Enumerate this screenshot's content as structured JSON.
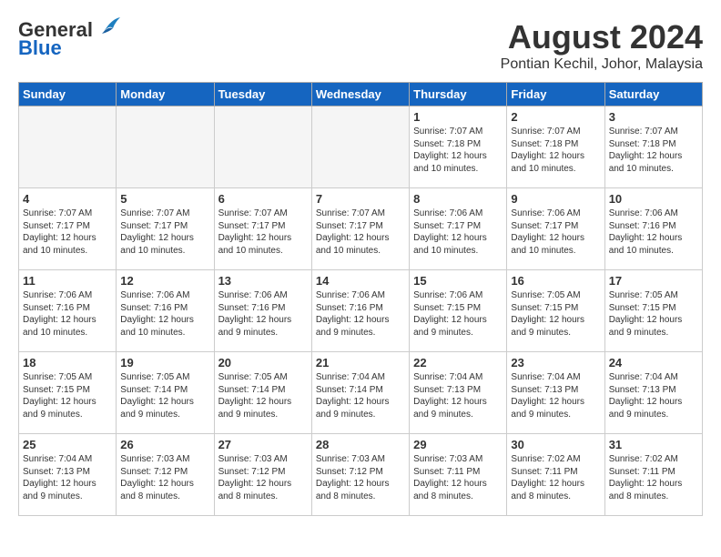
{
  "header": {
    "logo_general": "General",
    "logo_blue": "Blue",
    "main_title": "August 2024",
    "subtitle": "Pontian Kechil, Johor, Malaysia"
  },
  "calendar": {
    "days_of_week": [
      "Sunday",
      "Monday",
      "Tuesday",
      "Wednesday",
      "Thursday",
      "Friday",
      "Saturday"
    ],
    "weeks": [
      [
        {
          "day": "",
          "info": ""
        },
        {
          "day": "",
          "info": ""
        },
        {
          "day": "",
          "info": ""
        },
        {
          "day": "",
          "info": ""
        },
        {
          "day": "1",
          "info": "Sunrise: 7:07 AM\nSunset: 7:18 PM\nDaylight: 12 hours\nand 10 minutes."
        },
        {
          "day": "2",
          "info": "Sunrise: 7:07 AM\nSunset: 7:18 PM\nDaylight: 12 hours\nand 10 minutes."
        },
        {
          "day": "3",
          "info": "Sunrise: 7:07 AM\nSunset: 7:18 PM\nDaylight: 12 hours\nand 10 minutes."
        }
      ],
      [
        {
          "day": "4",
          "info": "Sunrise: 7:07 AM\nSunset: 7:17 PM\nDaylight: 12 hours\nand 10 minutes."
        },
        {
          "day": "5",
          "info": "Sunrise: 7:07 AM\nSunset: 7:17 PM\nDaylight: 12 hours\nand 10 minutes."
        },
        {
          "day": "6",
          "info": "Sunrise: 7:07 AM\nSunset: 7:17 PM\nDaylight: 12 hours\nand 10 minutes."
        },
        {
          "day": "7",
          "info": "Sunrise: 7:07 AM\nSunset: 7:17 PM\nDaylight: 12 hours\nand 10 minutes."
        },
        {
          "day": "8",
          "info": "Sunrise: 7:06 AM\nSunset: 7:17 PM\nDaylight: 12 hours\nand 10 minutes."
        },
        {
          "day": "9",
          "info": "Sunrise: 7:06 AM\nSunset: 7:17 PM\nDaylight: 12 hours\nand 10 minutes."
        },
        {
          "day": "10",
          "info": "Sunrise: 7:06 AM\nSunset: 7:16 PM\nDaylight: 12 hours\nand 10 minutes."
        }
      ],
      [
        {
          "day": "11",
          "info": "Sunrise: 7:06 AM\nSunset: 7:16 PM\nDaylight: 12 hours\nand 10 minutes."
        },
        {
          "day": "12",
          "info": "Sunrise: 7:06 AM\nSunset: 7:16 PM\nDaylight: 12 hours\nand 10 minutes."
        },
        {
          "day": "13",
          "info": "Sunrise: 7:06 AM\nSunset: 7:16 PM\nDaylight: 12 hours\nand 9 minutes."
        },
        {
          "day": "14",
          "info": "Sunrise: 7:06 AM\nSunset: 7:16 PM\nDaylight: 12 hours\nand 9 minutes."
        },
        {
          "day": "15",
          "info": "Sunrise: 7:06 AM\nSunset: 7:15 PM\nDaylight: 12 hours\nand 9 minutes."
        },
        {
          "day": "16",
          "info": "Sunrise: 7:05 AM\nSunset: 7:15 PM\nDaylight: 12 hours\nand 9 minutes."
        },
        {
          "day": "17",
          "info": "Sunrise: 7:05 AM\nSunset: 7:15 PM\nDaylight: 12 hours\nand 9 minutes."
        }
      ],
      [
        {
          "day": "18",
          "info": "Sunrise: 7:05 AM\nSunset: 7:15 PM\nDaylight: 12 hours\nand 9 minutes."
        },
        {
          "day": "19",
          "info": "Sunrise: 7:05 AM\nSunset: 7:14 PM\nDaylight: 12 hours\nand 9 minutes."
        },
        {
          "day": "20",
          "info": "Sunrise: 7:05 AM\nSunset: 7:14 PM\nDaylight: 12 hours\nand 9 minutes."
        },
        {
          "day": "21",
          "info": "Sunrise: 7:04 AM\nSunset: 7:14 PM\nDaylight: 12 hours\nand 9 minutes."
        },
        {
          "day": "22",
          "info": "Sunrise: 7:04 AM\nSunset: 7:13 PM\nDaylight: 12 hours\nand 9 minutes."
        },
        {
          "day": "23",
          "info": "Sunrise: 7:04 AM\nSunset: 7:13 PM\nDaylight: 12 hours\nand 9 minutes."
        },
        {
          "day": "24",
          "info": "Sunrise: 7:04 AM\nSunset: 7:13 PM\nDaylight: 12 hours\nand 9 minutes."
        }
      ],
      [
        {
          "day": "25",
          "info": "Sunrise: 7:04 AM\nSunset: 7:13 PM\nDaylight: 12 hours\nand 9 minutes."
        },
        {
          "day": "26",
          "info": "Sunrise: 7:03 AM\nSunset: 7:12 PM\nDaylight: 12 hours\nand 8 minutes."
        },
        {
          "day": "27",
          "info": "Sunrise: 7:03 AM\nSunset: 7:12 PM\nDaylight: 12 hours\nand 8 minutes."
        },
        {
          "day": "28",
          "info": "Sunrise: 7:03 AM\nSunset: 7:12 PM\nDaylight: 12 hours\nand 8 minutes."
        },
        {
          "day": "29",
          "info": "Sunrise: 7:03 AM\nSunset: 7:11 PM\nDaylight: 12 hours\nand 8 minutes."
        },
        {
          "day": "30",
          "info": "Sunrise: 7:02 AM\nSunset: 7:11 PM\nDaylight: 12 hours\nand 8 minutes."
        },
        {
          "day": "31",
          "info": "Sunrise: 7:02 AM\nSunset: 7:11 PM\nDaylight: 12 hours\nand 8 minutes."
        }
      ]
    ]
  }
}
